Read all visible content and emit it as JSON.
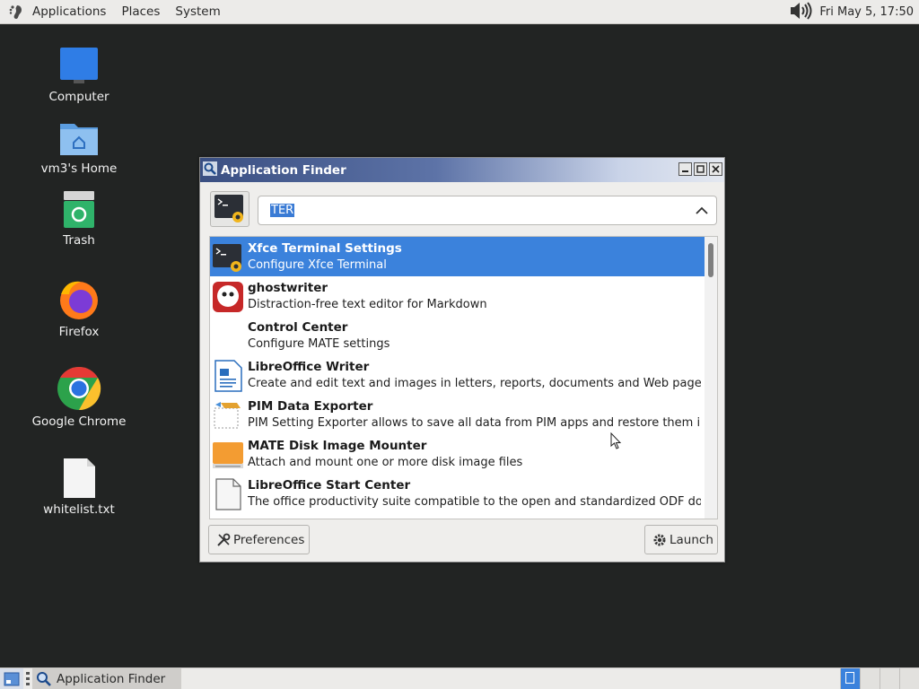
{
  "top_panel": {
    "menus": [
      "Applications",
      "Places",
      "System"
    ],
    "clock": "Fri May  5, 17:50",
    "icons": [
      "gnome-foot-icon",
      "volume-icon"
    ]
  },
  "desktop": {
    "icons": [
      {
        "label": "Computer",
        "icon": "monitor-icon"
      },
      {
        "label": "vm3's Home",
        "icon": "home-folder-icon"
      },
      {
        "label": "Trash",
        "icon": "trash-icon"
      },
      {
        "label": "Firefox",
        "icon": "firefox-icon"
      },
      {
        "label": "Google Chrome",
        "icon": "chrome-icon"
      },
      {
        "label": "whitelist.txt",
        "icon": "text-file-icon"
      }
    ]
  },
  "window": {
    "title": "Application Finder",
    "search": {
      "value": "TER",
      "selected": true
    },
    "results": [
      {
        "name": "Xfce Terminal Settings",
        "description": "Configure Xfce Terminal",
        "icon": "terminal-settings-icon",
        "selected": true
      },
      {
        "name": "ghostwriter",
        "description": "Distraction-free text editor for Markdown",
        "icon": "ghost-icon",
        "selected": false
      },
      {
        "name": "Control Center",
        "description": "Configure MATE settings",
        "icon": "",
        "selected": false
      },
      {
        "name": "LibreOffice Writer",
        "description": "Create and edit text and images in letters, reports, documents and Web pages b...",
        "icon": "writer-icon",
        "selected": false
      },
      {
        "name": "PIM Data Exporter",
        "description": "PIM Setting Exporter allows to save all data from PIM apps and restore them in o...",
        "icon": "pim-exporter-icon",
        "selected": false
      },
      {
        "name": "MATE Disk Image Mounter",
        "description": "Attach and mount one or more disk image files",
        "icon": "disk-image-icon",
        "selected": false
      },
      {
        "name": "LibreOffice Start Center",
        "description": "The office productivity suite compatible to the open and standardized ODF docu...",
        "icon": "document-icon",
        "selected": false
      }
    ],
    "buttons": {
      "preferences": "Preferences",
      "launch": "Launch"
    }
  },
  "taskbar": {
    "task": "Application Finder",
    "workspaces": 4,
    "active_workspace": 1
  },
  "colors": {
    "desktop_bg": "#222423",
    "selection": "#3b82dc",
    "titlebar_start": "#3a4f82"
  }
}
